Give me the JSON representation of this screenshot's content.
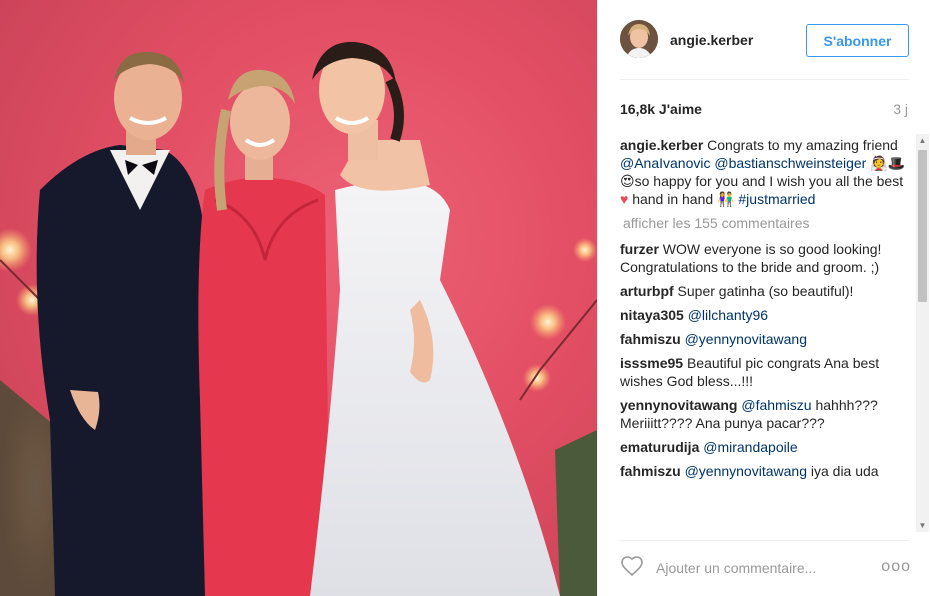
{
  "header": {
    "username": "angie.kerber",
    "follow_label": "S'abonner"
  },
  "stats": {
    "likes": "16,8k J'aime",
    "time": "3 j"
  },
  "caption": {
    "username": "angie.kerber",
    "text_1": " Congrats to my amazing friend ",
    "mention_1": "@AnaIvanovic",
    "mention_2": "@bastianschweinsteiger",
    "emoji_1": " 👰🎩😍",
    "text_2": "so happy for you and I wish you all the best ",
    "heart": "♥",
    "text_3": " hand in hand ",
    "emoji_2": "👫",
    "hashtag": " #justmarried"
  },
  "load_more": "afficher les 155 commentaires",
  "comments": [
    {
      "user": "furzer",
      "mention": "",
      "text": " WOW everyone is so good looking! Congratulations to the bride and groom. ;)"
    },
    {
      "user": "arturbpf",
      "mention": "",
      "text": " Super gatinha (so beautiful)!"
    },
    {
      "user": "nitaya305",
      "mention": " @lilchanty96",
      "text": ""
    },
    {
      "user": "fahmiszu",
      "mention": " @yennynovitawang",
      "text": ""
    },
    {
      "user": "isssme95",
      "mention": "",
      "text": " Beautiful pic congrats Ana best wishes God bless...!!!"
    },
    {
      "user": "yennynovitawang",
      "mention": " @fahmiszu",
      "text": " hahhh??? Meriiitt???? Ana punya pacar???"
    },
    {
      "user": "ematurudija",
      "mention": " @mirandapoile",
      "text": ""
    },
    {
      "user": "fahmiszu",
      "mention": " @yennynovitawang",
      "text": " iya dia uda"
    }
  ],
  "footer": {
    "placeholder": "Ajouter un commentaire...",
    "more": "ooo"
  },
  "colors": {
    "accent": "#3897f0",
    "mention": "#003569",
    "muted": "#999999",
    "heart": "#ed4956"
  },
  "icons": {
    "like": "heart-outline-icon",
    "more": "more-options-icon",
    "scroll_up": "scroll-up-icon",
    "scroll_down": "scroll-down-icon"
  }
}
